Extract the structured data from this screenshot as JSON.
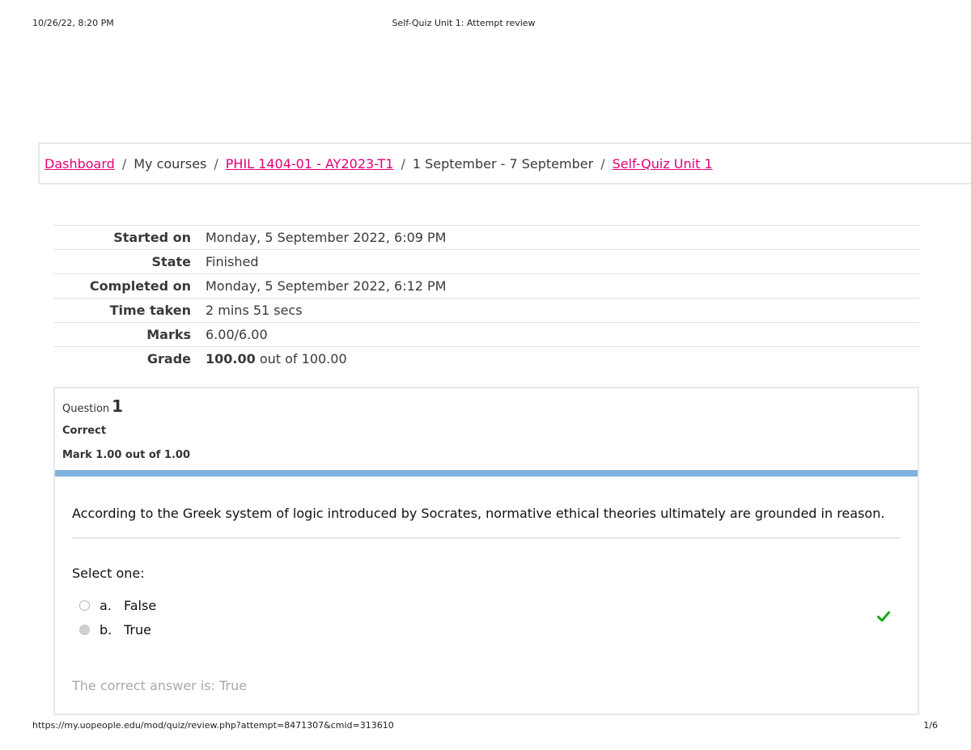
{
  "print_header": {
    "datetime": "10/26/22, 8:20 PM",
    "title": "Self-Quiz Unit 1: Attempt review"
  },
  "breadcrumb": {
    "items": [
      {
        "label": "Dashboard",
        "link": true
      },
      {
        "label": "My courses",
        "link": false
      },
      {
        "label": "PHIL 1404-01 - AY2023-T1",
        "link": true
      },
      {
        "label": "1 September - 7 September",
        "link": false
      },
      {
        "label": "Self-Quiz Unit 1",
        "link": true
      }
    ],
    "separator": "/"
  },
  "summary": {
    "rows": [
      {
        "label": "Started on",
        "value": "Monday, 5 September 2022, 6:09 PM"
      },
      {
        "label": "State",
        "value": "Finished"
      },
      {
        "label": "Completed on",
        "value": "Monday, 5 September 2022, 6:12 PM"
      },
      {
        "label": "Time taken",
        "value": "2 mins 51 secs"
      },
      {
        "label": "Marks",
        "value": "6.00/6.00"
      }
    ],
    "grade": {
      "label": "Grade",
      "strong": "100.00",
      "rest": " out of 100.00"
    }
  },
  "question": {
    "label": "Question",
    "number": "1",
    "state": "Correct",
    "mark": "Mark 1.00 out of 1.00",
    "text": "According to the Greek system of logic introduced by Socrates, normative ethical theories ultimately are grounded in reason.",
    "prompt": "Select one:",
    "options": [
      {
        "letter": "a.",
        "label": "False",
        "checked": false
      },
      {
        "letter": "b.",
        "label": "True",
        "checked": true
      }
    ],
    "correct_icon": "check-icon",
    "right_answer": "The correct answer is: True",
    "colors": {
      "bar": "#7fb2de",
      "check": "#1aa81a",
      "link": "#e1007a"
    }
  },
  "print_footer": {
    "url": "https://my.uopeople.edu/mod/quiz/review.php?attempt=8471307&cmid=313610",
    "page": "1/6"
  }
}
